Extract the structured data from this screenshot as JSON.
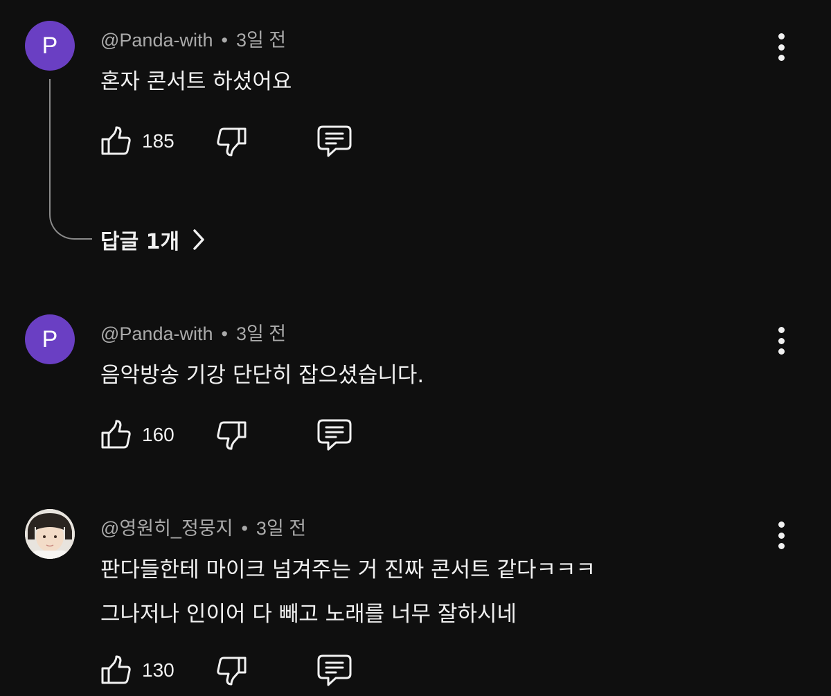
{
  "comments": [
    {
      "avatar_letter": "P",
      "author": "@Panda-with",
      "time": "3일 전",
      "lines": [
        "혼자 콘서트 하셨어요"
      ],
      "likes": "185",
      "replies_label": "답글 1개"
    },
    {
      "avatar_letter": "P",
      "author": "@Panda-with",
      "time": "3일 전",
      "lines": [
        "음악방송 기강 단단히 잡으셨습니다."
      ],
      "likes": "160"
    },
    {
      "author": "@영원히_정뭉지",
      "time": "3일 전",
      "lines": [
        "판다들한테 마이크 넘겨주는 거 진짜 콘서트 같다ㅋㅋㅋ",
        "그나저나 인이어 다 빼고 노래를 너무 잘하시네"
      ],
      "likes": "130"
    }
  ],
  "separator": "•",
  "colors": {
    "background": "#0f0f0f",
    "avatar": "#6a3fc3",
    "meta": "#aaaaaa",
    "text": "#f1f1f1"
  },
  "icons": [
    "thumbs-up-icon",
    "thumbs-down-icon",
    "reply-icon",
    "more-vert-icon",
    "chevron-right-icon"
  ]
}
